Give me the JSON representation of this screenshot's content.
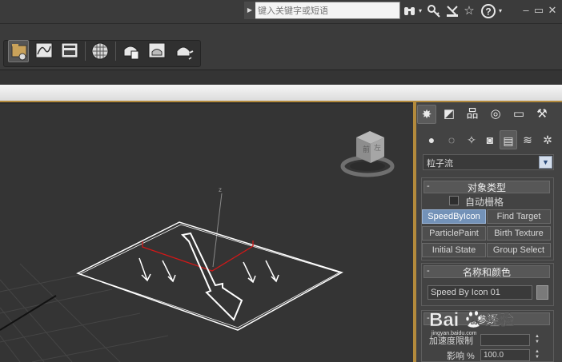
{
  "search": {
    "placeholder": "键入关键字或短语"
  },
  "titlebar": {
    "icons": [
      "binoculars-icon",
      "key-icon",
      "communication-icon",
      "star-icon",
      "help-icon"
    ],
    "window_controls": [
      "minimize",
      "restore",
      "close"
    ]
  },
  "toolbar": {
    "icons": [
      "scene-explorer-icon",
      "curve-editor-icon",
      "schematic-view-icon",
      "material-editor-icon",
      "render-setup-icon",
      "rendered-frame-icon",
      "render-icon"
    ]
  },
  "viewport": {
    "gizmo_axis_label": "z"
  },
  "command_panel": {
    "tabs": [
      {
        "name": "create",
        "glyph": "✸",
        "active": true
      },
      {
        "name": "modify",
        "glyph": "◩",
        "active": false
      },
      {
        "name": "hierarchy",
        "glyph": "品",
        "active": false
      },
      {
        "name": "motion",
        "glyph": "◎",
        "active": false
      },
      {
        "name": "display",
        "glyph": "▭",
        "active": false
      },
      {
        "name": "utilities",
        "glyph": "⚒",
        "active": false
      }
    ],
    "categories": [
      {
        "name": "geometry",
        "glyph": "●",
        "active": false
      },
      {
        "name": "shapes",
        "glyph": "◌",
        "active": false
      },
      {
        "name": "lights",
        "glyph": "✧",
        "active": false
      },
      {
        "name": "cameras",
        "glyph": "◙",
        "active": false
      },
      {
        "name": "helpers",
        "glyph": "▤",
        "active": true
      },
      {
        "name": "space-warps",
        "glyph": "≋",
        "active": false
      },
      {
        "name": "systems",
        "glyph": "✲",
        "active": false
      }
    ],
    "dropdown": {
      "selected": "粒子流"
    },
    "object_type": {
      "title": "对象类型",
      "minus": "-",
      "autogrid_label": "自动栅格",
      "buttons": [
        {
          "label": "SpeedByIcon",
          "pressed": true
        },
        {
          "label": "Find Target",
          "pressed": false
        },
        {
          "label": "ParticlePaint",
          "pressed": false
        },
        {
          "label": "Birth Texture",
          "pressed": false
        },
        {
          "label": "Initial State",
          "pressed": false
        },
        {
          "label": "Group Select",
          "pressed": false
        }
      ]
    },
    "name_color": {
      "title": "名称和颜色",
      "minus": "-",
      "name_value": "Speed By Icon 01",
      "swatch_color": "#7a7a7a"
    },
    "parameters": {
      "minus": "-",
      "title": "参数",
      "param1_label": "加速度限制",
      "param1_value": "",
      "param2_label": "影响 %",
      "param2_value": "100.0"
    }
  },
  "watermark": {
    "text": "Bai",
    "text2": "经验",
    "sub": "jingyan.baidu.com"
  },
  "colors": {
    "accent": "#b38a3c",
    "pressed_button": "#7392b8"
  }
}
